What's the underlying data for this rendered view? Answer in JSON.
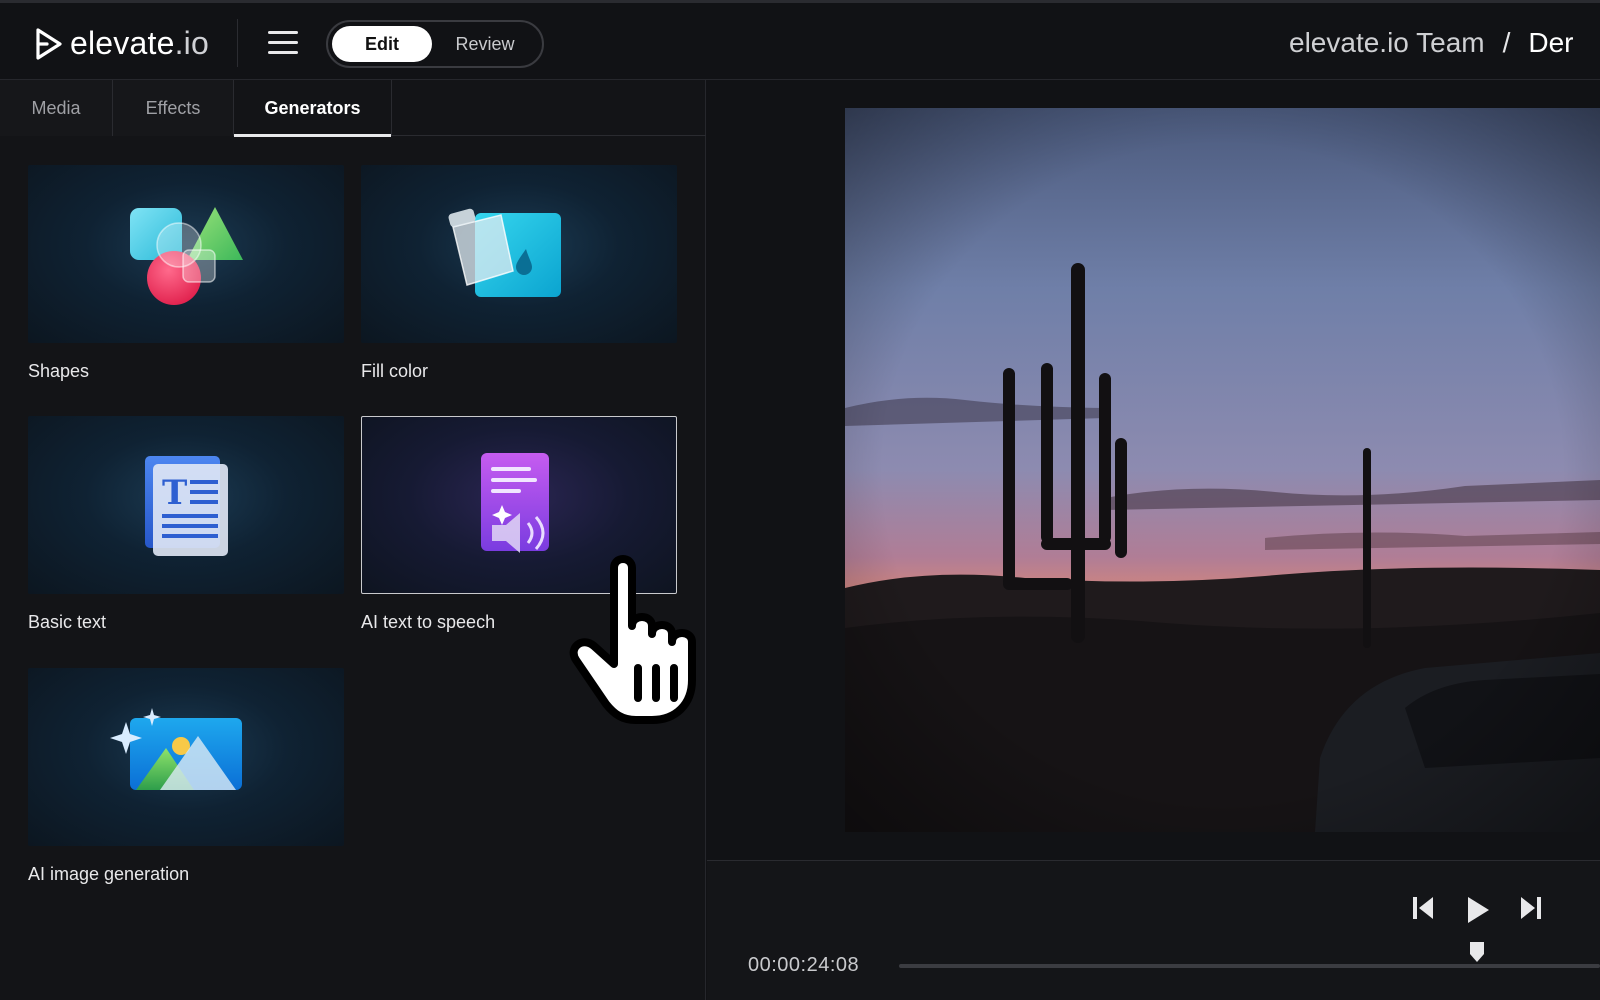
{
  "app": {
    "logo_text": "elevate",
    "logo_suffix": ".io"
  },
  "header": {
    "menu_icon": "hamburger-icon",
    "mode_edit_label": "Edit",
    "mode_review_label": "Review",
    "active_mode": "Edit",
    "breadcrumb": {
      "team": "elevate.io Team",
      "separator": "/",
      "current": "Der"
    }
  },
  "left_panel": {
    "tabs": [
      {
        "label": "Media",
        "active": false
      },
      {
        "label": "Effects",
        "active": false
      },
      {
        "label": "Generators",
        "active": true
      }
    ],
    "generators": [
      {
        "label": "Shapes",
        "icon": "shapes-icon"
      },
      {
        "label": "Fill color",
        "icon": "fill-color-icon"
      },
      {
        "label": "Basic text",
        "icon": "basic-text-icon"
      },
      {
        "label": "AI text to speech",
        "icon": "ai-text-to-speech-icon",
        "selected": true
      },
      {
        "label": "AI image generation",
        "icon": "ai-image-generation-icon"
      }
    ]
  },
  "player": {
    "timecode": "00:00:24:08",
    "buttons": {
      "previous": "skip-back-icon",
      "play": "play-icon",
      "next": "skip-forward-icon"
    }
  },
  "colors": {
    "background": "#111215",
    "panel": "#131417",
    "accent_white": "#ffffff",
    "border": "#2a2b30"
  }
}
